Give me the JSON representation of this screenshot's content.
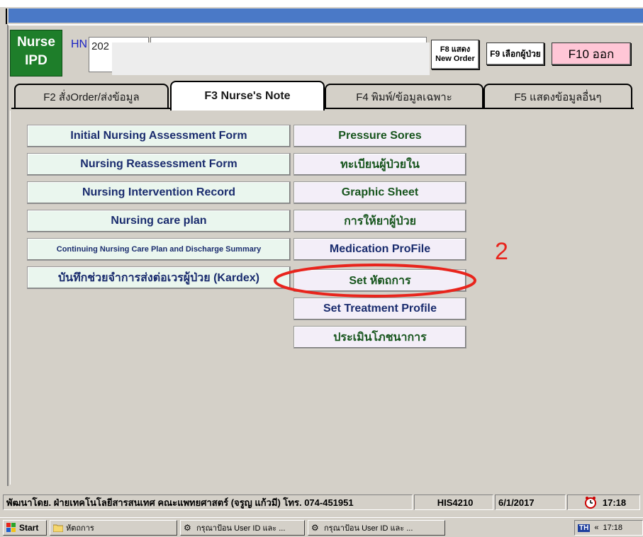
{
  "header": {
    "app_badge_line1": "Nurse",
    "app_badge_line2": "IPD",
    "hn_label": "HN",
    "hn_value": "202",
    "f8_line1": "F8 แสดง",
    "f8_line2": "New Order",
    "f9_label": "F9 เลือกผู้ป่วย",
    "f10_label": "F10 ออก"
  },
  "tabs": [
    {
      "label": "F2 สั่งOrder/ส่งข้อมูล"
    },
    {
      "label": "F3 Nurse's Note"
    },
    {
      "label": "F4 พิมพ์/ข้อมูลเฉพาะ"
    },
    {
      "label": "F5 แสดงข้อมูลอื่นๆ"
    }
  ],
  "left_buttons": [
    {
      "label": "Initial Nursing Assessment Form"
    },
    {
      "label": "Nursing Reassessment Form"
    },
    {
      "label": "Nursing Intervention Record"
    },
    {
      "label": "Nursing care plan"
    },
    {
      "label": "Continuing Nursing Care Plan and Discharge Summary"
    },
    {
      "label": "บันทึกช่วยจำการส่งต่อเวรผู้ป่วย (Kardex)"
    }
  ],
  "right_buttons": [
    {
      "label": "Pressure Sores"
    },
    {
      "label": "ทะเบียนผู้ป่วยใน"
    },
    {
      "label": "Graphic Sheet"
    },
    {
      "label": "การให้ยาผู้ป่วย"
    },
    {
      "label": "Medication ProFile"
    },
    {
      "label": "Set หัตถการ"
    },
    {
      "label": "Set Treatment Profile"
    },
    {
      "label": "ประเมินโภชนาการ"
    }
  ],
  "annotation": {
    "number": "2",
    "color": "#e8241c"
  },
  "status": {
    "developer": "พัฒนาโดย. ฝ่ายเทคโนโลยีสารสนเทศ คณะแพทยศาสตร์ (จรูญ แก้วมี) โทร. 074-451951",
    "system_code": "HIS4210",
    "date": "6/1/2017",
    "time": "17:18"
  },
  "taskbar": {
    "start_label": "Start",
    "items": [
      {
        "label": "หัตถการ",
        "icon": "folder-icon"
      },
      {
        "label": "กรุณาป้อน User ID และ ...",
        "icon": "app-icon"
      },
      {
        "label": "กรุณาป้อน User ID และ ...",
        "icon": "app-icon"
      }
    ],
    "lang": "TH",
    "clock": "17:18"
  },
  "colors": {
    "title_bar": "#4a79c7",
    "nurse_badge": "#1e7e2a",
    "f10_bg": "#ffc6d6",
    "left_button_bg": "#eaf6ee",
    "right_button_bg": "#f3eef8"
  }
}
